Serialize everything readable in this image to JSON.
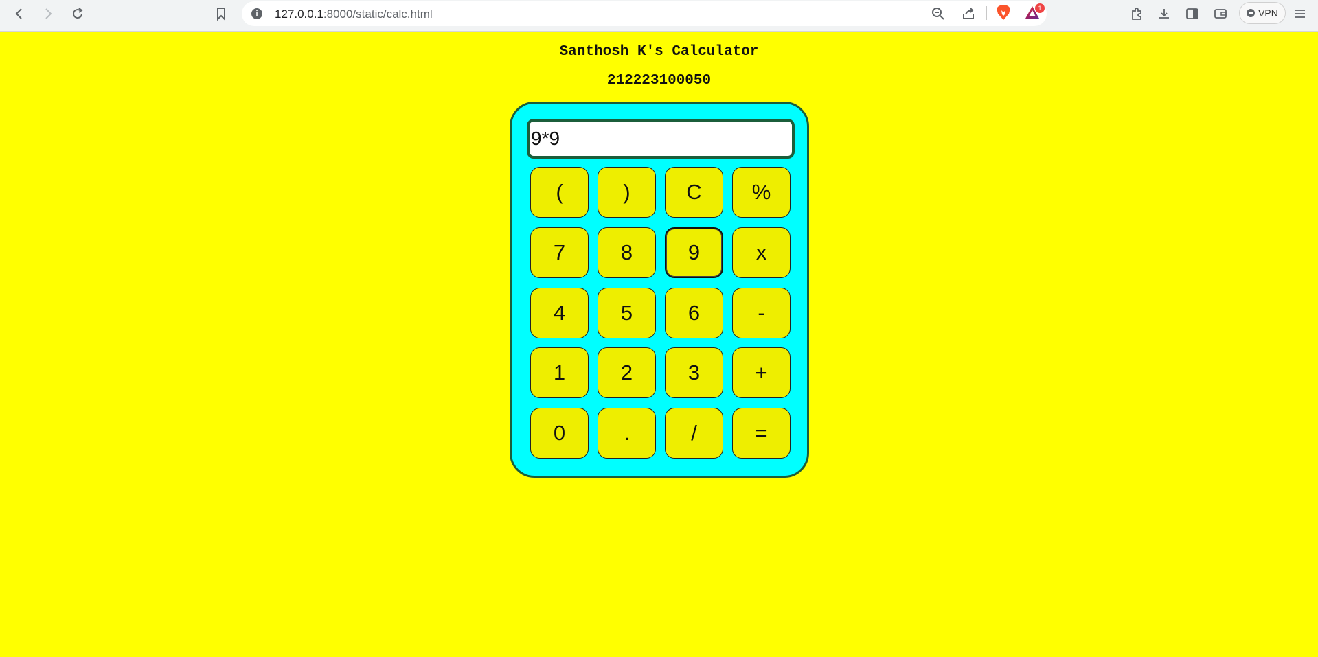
{
  "browser": {
    "url_host": "127.0.0.1",
    "url_path": ":8000/static/calc.html",
    "vpn_label": "VPN",
    "alert_badge_count": "1"
  },
  "page": {
    "title": "Santhosh K's Calculator",
    "register_number": "212223100050"
  },
  "calculator": {
    "display_value": "9*9",
    "keys": [
      [
        "(",
        ")",
        "C",
        "%"
      ],
      [
        "7",
        "8",
        "9",
        "x"
      ],
      [
        "4",
        "5",
        "6",
        "-"
      ],
      [
        "1",
        "2",
        "3",
        "+"
      ],
      [
        "0",
        ".",
        "/",
        "="
      ]
    ],
    "focused_key": "9"
  },
  "colors": {
    "page_background": "#ffff00",
    "calculator_body": "#00ffff",
    "key_background": "#eeee00",
    "border": "#1b5e3b"
  }
}
